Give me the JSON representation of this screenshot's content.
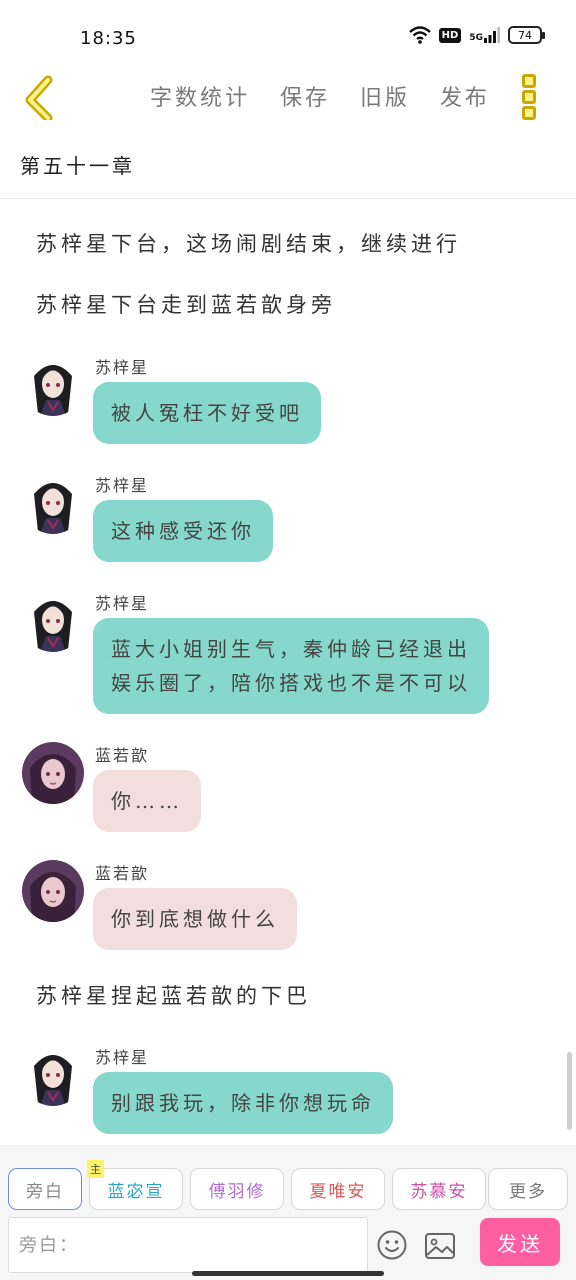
{
  "status_bar": {
    "time": "18:35",
    "hd_label": "HD",
    "network_label": "5G",
    "battery": "74"
  },
  "toolbar": {
    "back_icon": "chevron-left-icon",
    "actions": [
      {
        "label": "字数统计"
      },
      {
        "label": "保存"
      },
      {
        "label": "旧版"
      },
      {
        "label": "发布"
      }
    ],
    "more_icon": "vertical-dots-icon",
    "more_color": "#c9a800"
  },
  "chapter": {
    "title": "第五十一章"
  },
  "story": {
    "narration_1": "苏梓星下台，这场闹剧结束，继续进行",
    "narration_2": "苏梓星下台走到蓝若歆身旁",
    "messages": [
      {
        "speaker": "苏梓星",
        "lines": [
          "被人冤枉不好受吧"
        ]
      },
      {
        "speaker": "苏梓星",
        "lines": [
          "这种感受还你"
        ]
      },
      {
        "speaker": "苏梓星",
        "lines": [
          "蓝大小姐别生气，秦仲龄已经退出",
          "娱乐圈了，陪你搭戏也不是不可以"
        ]
      },
      {
        "speaker": "蓝若歆",
        "lines": [
          "你……"
        ]
      },
      {
        "speaker": "蓝若歆",
        "lines": [
          "你到底想做什么"
        ]
      },
      {
        "speaker": "苏梓星",
        "lines": [
          "别跟我玩，除非你想玩命"
        ]
      }
    ],
    "narration_3": "苏梓星捏起蓝若歆的下巴"
  },
  "composer": {
    "roles": [
      {
        "label": "旁白",
        "color": "#888888"
      },
      {
        "label": "蓝宓宣",
        "color": "#2aa6c7",
        "tag": "主"
      },
      {
        "label": "傅羽修",
        "color": "#b46cd6"
      },
      {
        "label": "夏唯安",
        "color": "#e05757"
      },
      {
        "label": "苏慕安",
        "color": "#d04fa4"
      },
      {
        "label": "更多",
        "color": "#777777"
      }
    ],
    "input_placeholder": "旁白：",
    "emoji_icon": "emoji-icon",
    "image_icon": "image-icon",
    "send_label": "发送",
    "send_color": "#ff5ea0",
    "teal_bubble": "#87d8cc",
    "pink_bubble": "#f3dede"
  }
}
